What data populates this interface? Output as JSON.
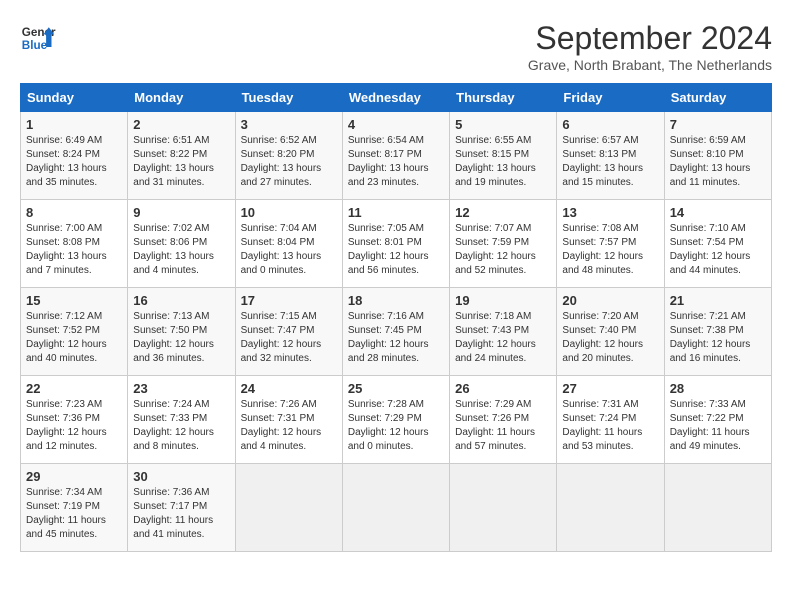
{
  "header": {
    "logo_line1": "General",
    "logo_line2": "Blue",
    "month_title": "September 2024",
    "subtitle": "Grave, North Brabant, The Netherlands"
  },
  "weekdays": [
    "Sunday",
    "Monday",
    "Tuesday",
    "Wednesday",
    "Thursday",
    "Friday",
    "Saturday"
  ],
  "weeks": [
    [
      {
        "day": "1",
        "info": "Sunrise: 6:49 AM\nSunset: 8:24 PM\nDaylight: 13 hours\nand 35 minutes."
      },
      {
        "day": "2",
        "info": "Sunrise: 6:51 AM\nSunset: 8:22 PM\nDaylight: 13 hours\nand 31 minutes."
      },
      {
        "day": "3",
        "info": "Sunrise: 6:52 AM\nSunset: 8:20 PM\nDaylight: 13 hours\nand 27 minutes."
      },
      {
        "day": "4",
        "info": "Sunrise: 6:54 AM\nSunset: 8:17 PM\nDaylight: 13 hours\nand 23 minutes."
      },
      {
        "day": "5",
        "info": "Sunrise: 6:55 AM\nSunset: 8:15 PM\nDaylight: 13 hours\nand 19 minutes."
      },
      {
        "day": "6",
        "info": "Sunrise: 6:57 AM\nSunset: 8:13 PM\nDaylight: 13 hours\nand 15 minutes."
      },
      {
        "day": "7",
        "info": "Sunrise: 6:59 AM\nSunset: 8:10 PM\nDaylight: 13 hours\nand 11 minutes."
      }
    ],
    [
      {
        "day": "8",
        "info": "Sunrise: 7:00 AM\nSunset: 8:08 PM\nDaylight: 13 hours\nand 7 minutes."
      },
      {
        "day": "9",
        "info": "Sunrise: 7:02 AM\nSunset: 8:06 PM\nDaylight: 13 hours\nand 4 minutes."
      },
      {
        "day": "10",
        "info": "Sunrise: 7:04 AM\nSunset: 8:04 PM\nDaylight: 13 hours\nand 0 minutes."
      },
      {
        "day": "11",
        "info": "Sunrise: 7:05 AM\nSunset: 8:01 PM\nDaylight: 12 hours\nand 56 minutes."
      },
      {
        "day": "12",
        "info": "Sunrise: 7:07 AM\nSunset: 7:59 PM\nDaylight: 12 hours\nand 52 minutes."
      },
      {
        "day": "13",
        "info": "Sunrise: 7:08 AM\nSunset: 7:57 PM\nDaylight: 12 hours\nand 48 minutes."
      },
      {
        "day": "14",
        "info": "Sunrise: 7:10 AM\nSunset: 7:54 PM\nDaylight: 12 hours\nand 44 minutes."
      }
    ],
    [
      {
        "day": "15",
        "info": "Sunrise: 7:12 AM\nSunset: 7:52 PM\nDaylight: 12 hours\nand 40 minutes."
      },
      {
        "day": "16",
        "info": "Sunrise: 7:13 AM\nSunset: 7:50 PM\nDaylight: 12 hours\nand 36 minutes."
      },
      {
        "day": "17",
        "info": "Sunrise: 7:15 AM\nSunset: 7:47 PM\nDaylight: 12 hours\nand 32 minutes."
      },
      {
        "day": "18",
        "info": "Sunrise: 7:16 AM\nSunset: 7:45 PM\nDaylight: 12 hours\nand 28 minutes."
      },
      {
        "day": "19",
        "info": "Sunrise: 7:18 AM\nSunset: 7:43 PM\nDaylight: 12 hours\nand 24 minutes."
      },
      {
        "day": "20",
        "info": "Sunrise: 7:20 AM\nSunset: 7:40 PM\nDaylight: 12 hours\nand 20 minutes."
      },
      {
        "day": "21",
        "info": "Sunrise: 7:21 AM\nSunset: 7:38 PM\nDaylight: 12 hours\nand 16 minutes."
      }
    ],
    [
      {
        "day": "22",
        "info": "Sunrise: 7:23 AM\nSunset: 7:36 PM\nDaylight: 12 hours\nand 12 minutes."
      },
      {
        "day": "23",
        "info": "Sunrise: 7:24 AM\nSunset: 7:33 PM\nDaylight: 12 hours\nand 8 minutes."
      },
      {
        "day": "24",
        "info": "Sunrise: 7:26 AM\nSunset: 7:31 PM\nDaylight: 12 hours\nand 4 minutes."
      },
      {
        "day": "25",
        "info": "Sunrise: 7:28 AM\nSunset: 7:29 PM\nDaylight: 12 hours\nand 0 minutes."
      },
      {
        "day": "26",
        "info": "Sunrise: 7:29 AM\nSunset: 7:26 PM\nDaylight: 11 hours\nand 57 minutes."
      },
      {
        "day": "27",
        "info": "Sunrise: 7:31 AM\nSunset: 7:24 PM\nDaylight: 11 hours\nand 53 minutes."
      },
      {
        "day": "28",
        "info": "Sunrise: 7:33 AM\nSunset: 7:22 PM\nDaylight: 11 hours\nand 49 minutes."
      }
    ],
    [
      {
        "day": "29",
        "info": "Sunrise: 7:34 AM\nSunset: 7:19 PM\nDaylight: 11 hours\nand 45 minutes."
      },
      {
        "day": "30",
        "info": "Sunrise: 7:36 AM\nSunset: 7:17 PM\nDaylight: 11 hours\nand 41 minutes."
      },
      {
        "day": "",
        "info": ""
      },
      {
        "day": "",
        "info": ""
      },
      {
        "day": "",
        "info": ""
      },
      {
        "day": "",
        "info": ""
      },
      {
        "day": "",
        "info": ""
      }
    ]
  ]
}
